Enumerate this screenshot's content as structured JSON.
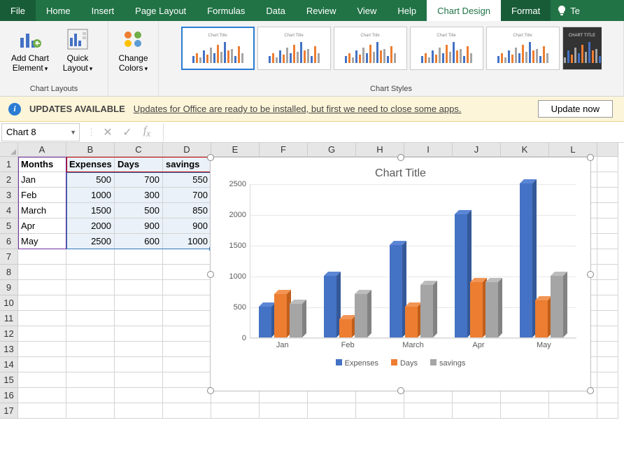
{
  "ribbon": {
    "tabs": [
      "File",
      "Home",
      "Insert",
      "Page Layout",
      "Formulas",
      "Data",
      "Review",
      "View",
      "Help",
      "Chart Design",
      "Format"
    ],
    "active_tab": "Chart Design",
    "groups": {
      "chart_layouts": {
        "label": "Chart Layouts",
        "add_chart_element": "Add Chart\nElement",
        "quick_layout": "Quick\nLayout"
      },
      "change_colors": "Change\nColors",
      "chart_styles": {
        "label": "Chart Styles"
      }
    }
  },
  "update_bar": {
    "title": "UPDATES AVAILABLE",
    "message": "Updates for Office are ready to be installed, but first we need to close some apps.",
    "button": "Update now"
  },
  "name_box": "Chart 8",
  "columns": [
    "A",
    "B",
    "C",
    "D",
    "E",
    "F",
    "G",
    "H",
    "I",
    "J",
    "K",
    "L"
  ],
  "rows": 17,
  "sheet": {
    "headers": [
      "Months",
      "Expenses",
      "Days",
      "savings"
    ],
    "data": [
      {
        "month": "Jan",
        "expenses": 500,
        "days": 700,
        "savings": 550
      },
      {
        "month": "Feb",
        "expenses": 1000,
        "days": 300,
        "savings": 700
      },
      {
        "month": "March",
        "expenses": 1500,
        "days": 500,
        "savings": 850
      },
      {
        "month": "Apr",
        "expenses": 2000,
        "days": 900,
        "savings": 900
      },
      {
        "month": "May",
        "expenses": 2500,
        "days": 600,
        "savings": 1000
      }
    ]
  },
  "chart": {
    "title": "Chart Title",
    "legend": [
      "Expenses",
      "Days",
      "savings"
    ],
    "colors": {
      "Expenses": "#4472c4",
      "Days": "#ed7d31",
      "savings": "#a5a5a5"
    },
    "y_ticks": [
      0,
      500,
      1000,
      1500,
      2000,
      2500
    ]
  },
  "chart_data": {
    "type": "bar",
    "title": "Chart Title",
    "categories": [
      "Jan",
      "Feb",
      "March",
      "Apr",
      "May"
    ],
    "series": [
      {
        "name": "Expenses",
        "values": [
          500,
          1000,
          1500,
          2000,
          2500
        ]
      },
      {
        "name": "Days",
        "values": [
          700,
          300,
          500,
          900,
          600
        ]
      },
      {
        "name": "savings",
        "values": [
          550,
          700,
          850,
          900,
          1000
        ]
      }
    ],
    "ylim": [
      0,
      2500
    ],
    "xlabel": "",
    "ylabel": ""
  }
}
